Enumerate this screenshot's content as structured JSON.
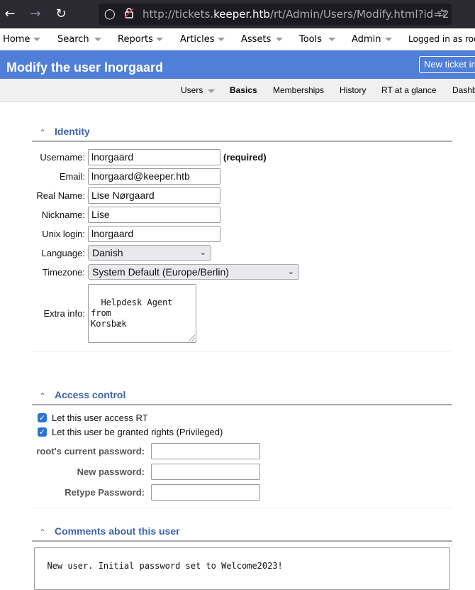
{
  "browser": {
    "url_prefix": "http://tickets.",
    "url_domain": "keeper.htb",
    "url_path": "/rt/Admin/Users/Modify.html?id=2"
  },
  "topmenu": {
    "items": [
      "Home",
      "Search",
      "Reports",
      "Articles",
      "Assets",
      "Tools",
      "Admin"
    ],
    "logged_in": "Logged in as root"
  },
  "header": {
    "title": "Modify the user lnorgaard",
    "new_ticket": "New ticket in"
  },
  "subnav": {
    "items": [
      "Users",
      "Basics",
      "Memberships",
      "History",
      "RT at a glance",
      "Dashboards"
    ]
  },
  "identity": {
    "title": "Identity",
    "username_label": "Username:",
    "username": "lnorgaard",
    "required": "(required)",
    "email_label": "Email:",
    "email": "lnorgaard@keeper.htb",
    "realname_label": "Real Name:",
    "realname": "Lise Nørgaard",
    "nickname_label": "Nickname:",
    "nickname": "Lise",
    "unixlogin_label": "Unix login:",
    "unixlogin": "lnorgaard",
    "language_label": "Language:",
    "language": "Danish",
    "timezone_label": "Timezone:",
    "timezone": "System Default (Europe/Berlin)",
    "extrainfo_label": "Extra info:",
    "extrainfo": "Helpdesk Agent from\nKorsbæk"
  },
  "access": {
    "title": "Access control",
    "cb1": "Let this user access RT",
    "cb2": "Let this user be granted rights (Privileged)",
    "current_pw_label": "root's current password:",
    "new_pw_label": "New password:",
    "retype_pw_label": "Retype Password:"
  },
  "comments": {
    "title": "Comments about this user",
    "text": "New user. Initial password set to Welcome2023!"
  }
}
